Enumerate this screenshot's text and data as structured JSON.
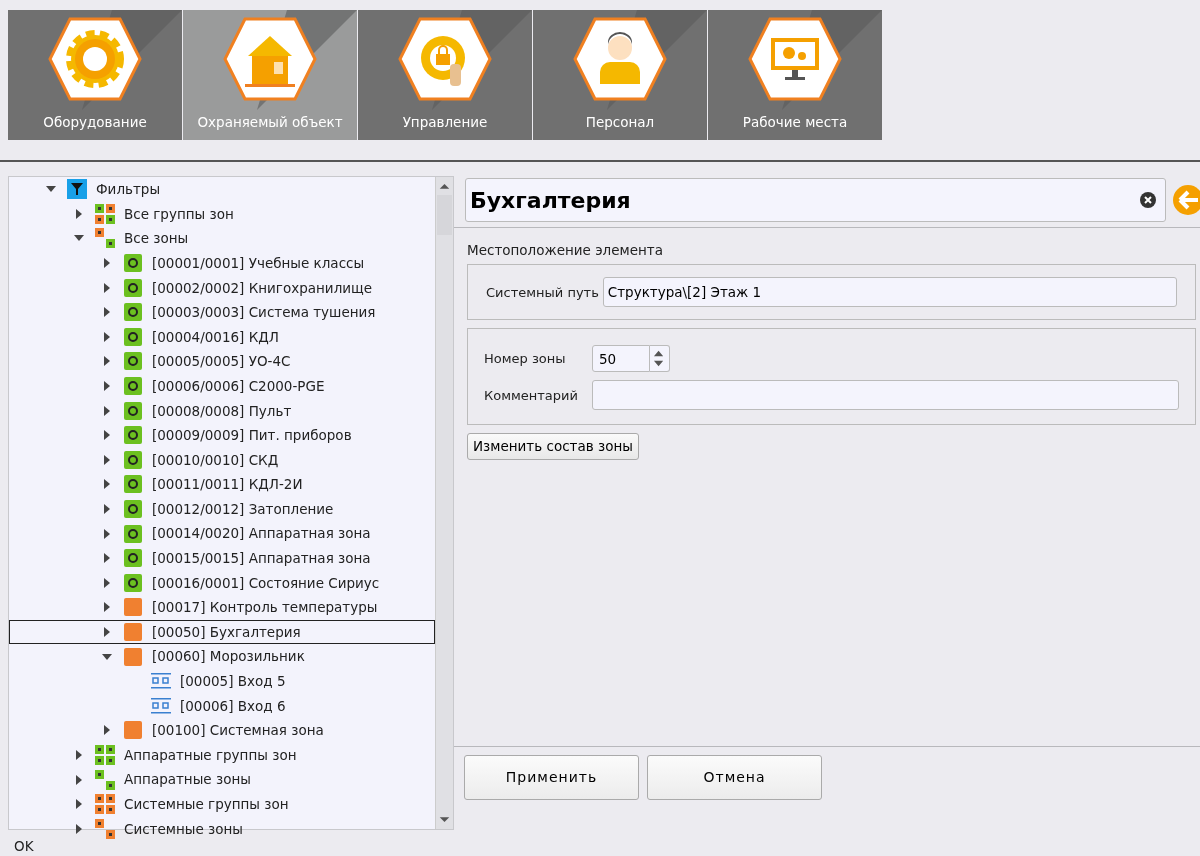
{
  "tabs": [
    {
      "label": "Оборудование",
      "kind": "gear",
      "selected": false
    },
    {
      "label": "Охраняемый объект",
      "kind": "house",
      "selected": true
    },
    {
      "label": "Управление",
      "kind": "lock",
      "selected": false
    },
    {
      "label": "Персонал",
      "kind": "person",
      "selected": false
    },
    {
      "label": "Рабочие места",
      "kind": "monitor",
      "selected": false
    }
  ],
  "tree": [
    {
      "label": "Фильтры",
      "kind": "filter",
      "expanded": true,
      "selected": false,
      "children": [
        {
          "label": "Все группы зон",
          "kind": "groups-mixed",
          "expanded": false,
          "selected": false
        },
        {
          "label": "Все зоны",
          "kind": "zones-mixed",
          "expanded": true,
          "selected": false,
          "children": [
            {
              "label": "[00001/0001] Учебные классы",
              "kind": "zone-green",
              "expanded": false,
              "selected": false
            },
            {
              "label": "[00002/0002] Книгохранилище",
              "kind": "zone-green",
              "expanded": false,
              "selected": false
            },
            {
              "label": "[00003/0003] Система тушения",
              "kind": "zone-green",
              "expanded": false,
              "selected": false
            },
            {
              "label": "[00004/0016] КДЛ",
              "kind": "zone-green",
              "expanded": false,
              "selected": false
            },
            {
              "label": "[00005/0005] УО-4С",
              "kind": "zone-green",
              "expanded": false,
              "selected": false
            },
            {
              "label": "[00006/0006] С2000-PGE",
              "kind": "zone-green",
              "expanded": false,
              "selected": false
            },
            {
              "label": "[00008/0008] Пульт",
              "kind": "zone-green",
              "expanded": false,
              "selected": false
            },
            {
              "label": "[00009/0009] Пит. приборов",
              "kind": "zone-green",
              "expanded": false,
              "selected": false
            },
            {
              "label": "[00010/0010] СКД",
              "kind": "zone-green",
              "expanded": false,
              "selected": false
            },
            {
              "label": "[00011/0011] КДЛ-2И",
              "kind": "zone-green",
              "expanded": false,
              "selected": false
            },
            {
              "label": "[00012/0012] Затопление",
              "kind": "zone-green",
              "expanded": false,
              "selected": false
            },
            {
              "label": "[00014/0020] Аппаратная зона",
              "kind": "zone-green",
              "expanded": false,
              "selected": false
            },
            {
              "label": "[00015/0015] Аппаратная зона",
              "kind": "zone-green",
              "expanded": false,
              "selected": false
            },
            {
              "label": "[00016/0001] Состояние Сириус",
              "kind": "zone-green",
              "expanded": false,
              "selected": false
            },
            {
              "label": "[00017] Контроль температуры",
              "kind": "zone-orange",
              "expanded": false,
              "selected": false
            },
            {
              "label": "[00050] Бухгалтерия",
              "kind": "zone-orange",
              "expanded": false,
              "selected": true
            },
            {
              "label": "[00060] Морозильник",
              "kind": "zone-orange",
              "expanded": true,
              "selected": false,
              "children": [
                {
                  "label": "[00005] Вход 5",
                  "kind": "input",
                  "selected": false
                },
                {
                  "label": "[00006] Вход 6",
                  "kind": "input",
                  "selected": false
                }
              ]
            },
            {
              "label": "[00100] Системная зона",
              "kind": "zone-orange",
              "expanded": false,
              "selected": false
            }
          ]
        },
        {
          "label": "Аппаратные группы зон",
          "kind": "groups-green",
          "expanded": false,
          "selected": false
        },
        {
          "label": "Аппаратные зоны",
          "kind": "zones-green",
          "expanded": false,
          "selected": false
        },
        {
          "label": "Системные группы зон",
          "kind": "groups-orange",
          "expanded": false,
          "selected": false
        },
        {
          "label": "Системные зоны",
          "kind": "zones-orange",
          "expanded": false,
          "selected": false
        }
      ]
    }
  ],
  "editor": {
    "title": "Бухгалтерия",
    "section_label": "Местоположение элемента",
    "system_path": {
      "label": "Системный путь",
      "value": "Структура\\[2] Этаж 1"
    },
    "zone_number": {
      "label": "Номер зоны",
      "value": "50"
    },
    "comment": {
      "label": "Комментарий"
    },
    "change_button": "Изменить состав зоны",
    "buttons": [
      "Применить",
      "Отмена"
    ]
  },
  "status_bar": "OK"
}
